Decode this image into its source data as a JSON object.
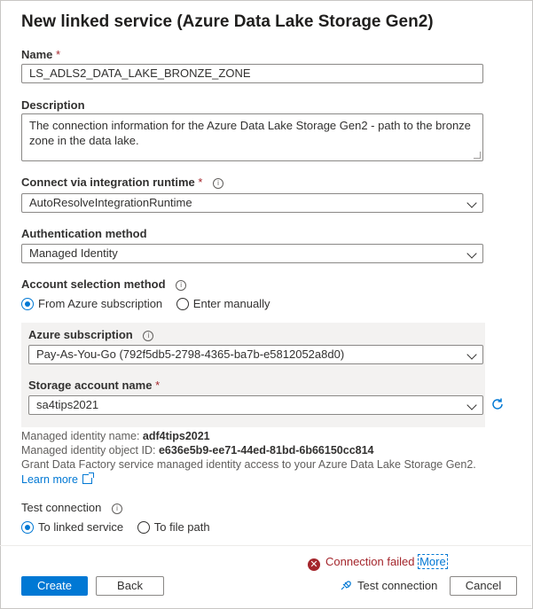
{
  "title": "New linked service (Azure Data Lake Storage Gen2)",
  "name": {
    "label": "Name",
    "required": "*",
    "value": "LS_ADLS2_DATA_LAKE_BRONZE_ZONE"
  },
  "description": {
    "label": "Description",
    "value": "The connection information for the Azure Data Lake Storage Gen2 - path to the bronze zone in the data lake."
  },
  "runtime": {
    "label": "Connect via integration runtime",
    "required": "*",
    "value": "AutoResolveIntegrationRuntime"
  },
  "auth": {
    "label": "Authentication method",
    "value": "Managed Identity"
  },
  "account_selection": {
    "label": "Account selection method",
    "options": [
      {
        "label": "From Azure subscription",
        "selected": true
      },
      {
        "label": "Enter manually",
        "selected": false
      }
    ]
  },
  "subscription": {
    "label": "Azure subscription",
    "value": "Pay-As-You-Go (792f5db5-2798-4365-ba7b-e5812052a8d0)"
  },
  "storage": {
    "label": "Storage account name",
    "required": "*",
    "value": "sa4tips2021"
  },
  "identity": {
    "name_label": "Managed identity name:",
    "name_value": "adf4tips2021",
    "id_label": "Managed identity object ID:",
    "id_value": "e636e5b9-ee71-44ed-81bd-6b66150cc814",
    "grant_text": "Grant Data Factory service managed identity access to your Azure Data Lake Storage Gen2.",
    "learn_more": "Learn more"
  },
  "test": {
    "label": "Test connection",
    "options": [
      {
        "label": "To linked service",
        "selected": true
      },
      {
        "label": "To file path",
        "selected": false
      }
    ]
  },
  "status": {
    "text": "Connection failed",
    "more": "More"
  },
  "footer": {
    "create": "Create",
    "back": "Back",
    "test_connection": "Test connection",
    "cancel": "Cancel"
  },
  "colors": {
    "accent": "#0078d4",
    "error": "#a4262c"
  },
  "icons": [
    "info-icon",
    "chevron-down-icon",
    "refresh-icon",
    "external-link-icon",
    "error-icon",
    "plug-icon"
  ]
}
